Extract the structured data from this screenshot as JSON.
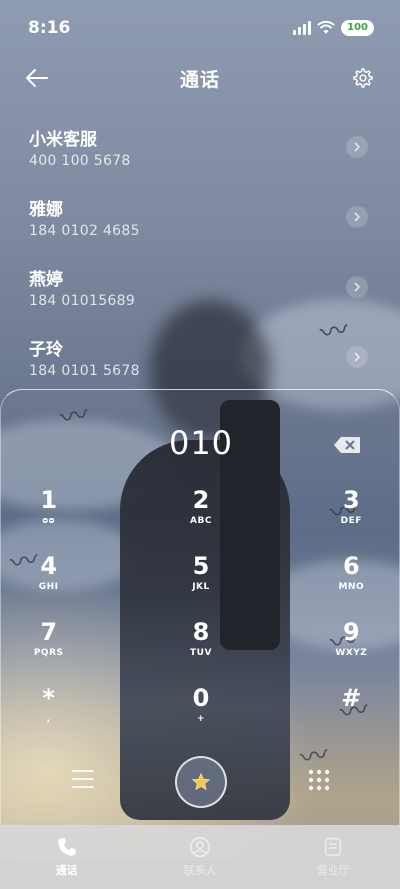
{
  "status_bar": {
    "time": "8:16",
    "battery": "100",
    "battery_color": "#3a9f4e"
  },
  "header": {
    "title": "通话",
    "back_icon": "arrow-left-icon",
    "settings_icon": "gear-icon"
  },
  "contacts": [
    {
      "name": "小米客服",
      "number": "400 100 5678"
    },
    {
      "name": "雅娜",
      "number": "184 0102 4685"
    },
    {
      "name": "燕婷",
      "number": "184 01015689"
    },
    {
      "name": "子玲",
      "number": "184 0101 5678"
    }
  ],
  "dialpad": {
    "entered_number": "010",
    "keys": [
      {
        "digit": "1",
        "letters": "ᴑᴑ"
      },
      {
        "digit": "2",
        "letters": "ABC"
      },
      {
        "digit": "3",
        "letters": "DEF"
      },
      {
        "digit": "4",
        "letters": "GHI"
      },
      {
        "digit": "5",
        "letters": "JKL"
      },
      {
        "digit": "6",
        "letters": "MNO"
      },
      {
        "digit": "7",
        "letters": "PQRS"
      },
      {
        "digit": "8",
        "letters": "TUV"
      },
      {
        "digit": "9",
        "letters": "WXYZ"
      },
      {
        "digit": "*",
        "letters": ","
      },
      {
        "digit": "0",
        "letters": "+"
      },
      {
        "digit": "#",
        "letters": ""
      }
    ],
    "call_icon": "star-call-icon"
  },
  "bottom_nav": {
    "tabs": [
      {
        "label": "通话",
        "icon": "phone-icon",
        "active": true
      },
      {
        "label": "联系人",
        "icon": "contact-icon",
        "active": false
      },
      {
        "label": "营业厅",
        "icon": "service-hall-icon",
        "active": false
      }
    ]
  }
}
